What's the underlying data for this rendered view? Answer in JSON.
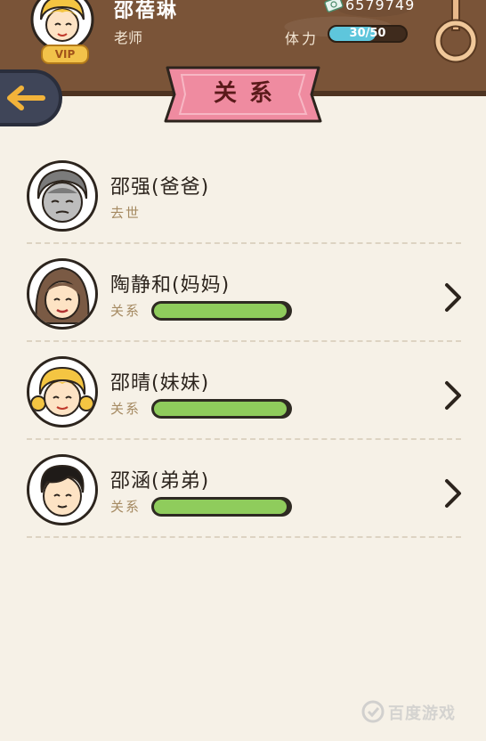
{
  "header": {
    "player_name": "邵蓓琳",
    "player_title": "老师",
    "vip_label": "VIP",
    "money": "6579749",
    "stamina_label": "体力",
    "stamina_text": "30/50",
    "stamina_ratio": 0.6,
    "icons": {
      "money": "banknote-icon",
      "ring": "ring-icon",
      "back": "arrow-left-icon"
    }
  },
  "page": {
    "title": "关系"
  },
  "relations": [
    {
      "name": "邵强(爸爸)",
      "status": "去世",
      "has_bar": false,
      "has_chevron": false,
      "avatar": "grandfather-gray"
    },
    {
      "name": "陶静和(妈妈)",
      "status": "关系",
      "has_bar": true,
      "bar_ratio": 0.98,
      "has_chevron": true,
      "avatar": "mother-brown-hair"
    },
    {
      "name": "邵晴(妹妹)",
      "status": "关系",
      "has_bar": true,
      "bar_ratio": 0.98,
      "has_chevron": true,
      "avatar": "girl-blonde-pigtails"
    },
    {
      "name": "邵涵(弟弟)",
      "status": "关系",
      "has_bar": true,
      "bar_ratio": 0.98,
      "has_chevron": true,
      "avatar": "boy-black-hair"
    }
  ],
  "colors": {
    "header_bg": "#7a5438",
    "page_bg": "#f6f1e7",
    "banner": "#ef8ba0",
    "relation_bar": "#8fcc5c",
    "stamina_bar": "#5ec6dc"
  },
  "watermark": {
    "text": "百度游戏"
  }
}
